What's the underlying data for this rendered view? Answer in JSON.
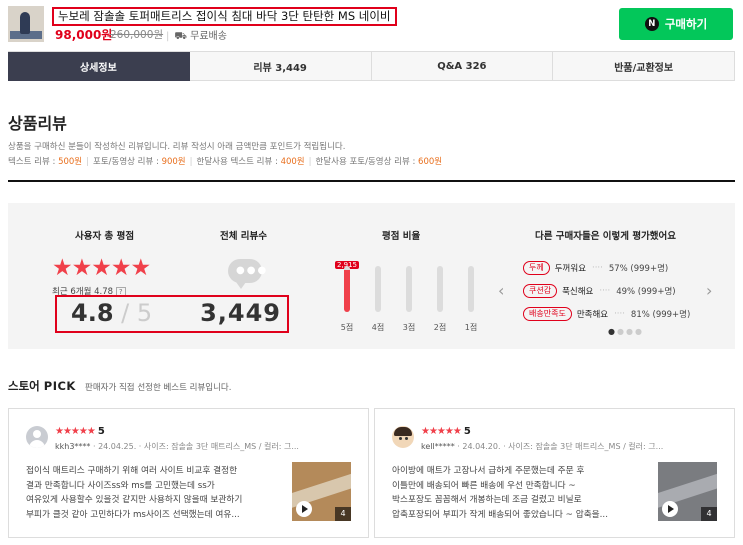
{
  "header": {
    "product_title": "누보레 잠솔솔 토퍼매트리스 접이식 침대 바닥 3단 탄탄한 MS 네이비",
    "price": "98,000원",
    "original_price": "260,000원",
    "shipping_icon": "truck-icon",
    "shipping": "무료배송",
    "buy_icon_letter": "N",
    "buy_label": "구매하기",
    "buy_color": "#03c75a"
  },
  "tabs": [
    {
      "label": "상세정보",
      "active": true
    },
    {
      "label": "리뷰 3,449",
      "active": false
    },
    {
      "label": "Q&A 326",
      "active": false
    },
    {
      "label": "반품/교환정보",
      "active": false
    }
  ],
  "reviews": {
    "title": "상품리뷰",
    "desc_line1": "상품을 구매하신 분들이 작성하신 리뷰입니다. 리뷰 작성시 아래 금액만큼 포인트가 적립됩니다.",
    "desc_items": [
      {
        "label": "텍스트 리뷰 : ",
        "amount": "500원"
      },
      {
        "label": "포토/동영상 리뷰 : ",
        "amount": "900원"
      },
      {
        "label": "한달사용 텍스트 리뷰 : ",
        "amount": "400원"
      },
      {
        "label": "한달사용 포토/동영상 리뷰 : ",
        "amount": "600원"
      }
    ]
  },
  "summary": {
    "avg_heading": "사용자 총 평점",
    "stars": "★★★★★",
    "recent_label": "최근 6개월 4.78",
    "recent_help": "?",
    "avg_score": "4.8",
    "avg_max": "5",
    "total_heading": "전체 리뷰수",
    "total_icon": "speech-bubble-icon",
    "total_count": "3,449",
    "ratio_heading": "평점 비율",
    "ratio_bars": [
      {
        "label": "5점",
        "fraction": 0.92,
        "value": "2,915",
        "highlight": true
      },
      {
        "label": "4점",
        "fraction": 0.0
      },
      {
        "label": "3점",
        "fraction": 0.0
      },
      {
        "label": "2점",
        "fraction": 0.0
      },
      {
        "label": "1점",
        "fraction": 0.0
      }
    ],
    "eval_heading": "다른 구매자들은 이렇게 평가했어요",
    "traits": [
      {
        "tag": "두께",
        "value": "두꺼워요",
        "pct": "57% (999+명)"
      },
      {
        "tag": "쿠션감",
        "value": "푹신해요",
        "pct": "49% (999+명)"
      },
      {
        "tag": "배송만족도",
        "value": "만족해요",
        "pct": "81% (999+명)"
      }
    ],
    "accent_color": "#f0404a"
  },
  "pick": {
    "title_prefix": "스토어",
    "title_pick": "PICK",
    "subtitle": "판매자가 직접 선정한 베스트 리뷰입니다.",
    "cards": [
      {
        "stars": "★★★★★",
        "score": "5",
        "user": "kkh3****",
        "date": "24.04.25.",
        "option": "사이즈: 잠솔솔 3단 매트리스_MS / 컬러: 그...",
        "lines": [
          "접이식 매트리스 구매하기 위해 여러 사이트 비교후 결정한",
          "결과 만족합니다 사이즈ss와 ms를 고민했는데 ss가",
          "여유있게 사용할수 있을것 같지만 사용하지 않을때 보관하기",
          "부피가 클것 같아 고민하다가 ms사이즈 선택했는데 여유..."
        ],
        "media_count": "4"
      },
      {
        "stars": "★★★★★",
        "score": "5",
        "user": "kell*****",
        "date": "24.04.20.",
        "option": "사이즈: 잠솔솔 3단 매트리스_MS / 컬러: 그...",
        "lines": [
          "아이방에 매트가 고장나서 급하게 주문했는데 주문 후",
          "이틀만에 배송되어 빠른 배송에 우선 만족합니다 ~",
          "박스포장도 꼼꼼해서 개봉하는데 조금 걸렸고 비닐로",
          "압축포장되어 부피가 작게 배송되어 좋았습니다 ~ 압축을..."
        ],
        "media_count": "4"
      }
    ]
  }
}
